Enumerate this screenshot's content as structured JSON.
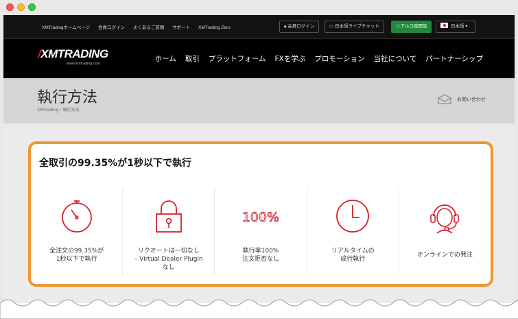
{
  "topbar": {
    "links": [
      "XMTradingホームページ",
      "会員ログイン",
      "よくあるご質問",
      "サポート",
      "XMTrading Zero"
    ],
    "member_login": "会員ログイン",
    "live_chat": "日本語ライブチャット",
    "open_account": "リアル口座開設",
    "language": "日本語"
  },
  "brand": {
    "logo": "XMTRADING",
    "logo_sub": "www.xmtrading.com"
  },
  "nav": {
    "items": [
      "ホーム",
      "取引",
      "プラットフォーム",
      "FXを学ぶ",
      "プロモーション",
      "当社について",
      "パートナーシップ"
    ]
  },
  "page": {
    "title": "執行方法",
    "breadcrumb": "XMTrading  ›  執行方法",
    "contact": "お問い合わせ"
  },
  "highlight": {
    "title": "全取引の99.35%が1秒以下で執行",
    "features": [
      {
        "icon": "stopwatch-icon",
        "line1": "全注文の99.35%が",
        "line2": "1秒以下で執行",
        "line3": ""
      },
      {
        "icon": "padlock-icon",
        "line1": "リクオートは一切なし",
        "line2": "– Virtual Dealer Plugin",
        "line3": "なし"
      },
      {
        "icon": "percent-icon",
        "icon_text": "100%",
        "line1": "執行率100%",
        "line2": "注文拒否なし",
        "line3": ""
      },
      {
        "icon": "clock-icon",
        "line1": "リアルタイムの",
        "line2": "成行執行",
        "line3": ""
      },
      {
        "icon": "headset-icon",
        "line1": "オンラインでの発注",
        "line2": "",
        "line3": ""
      }
    ]
  },
  "colors": {
    "accent": "#d4202c",
    "highlight_border": "#f0972f",
    "nav_bg": "#000000",
    "green_button": "#1f8a3c"
  }
}
